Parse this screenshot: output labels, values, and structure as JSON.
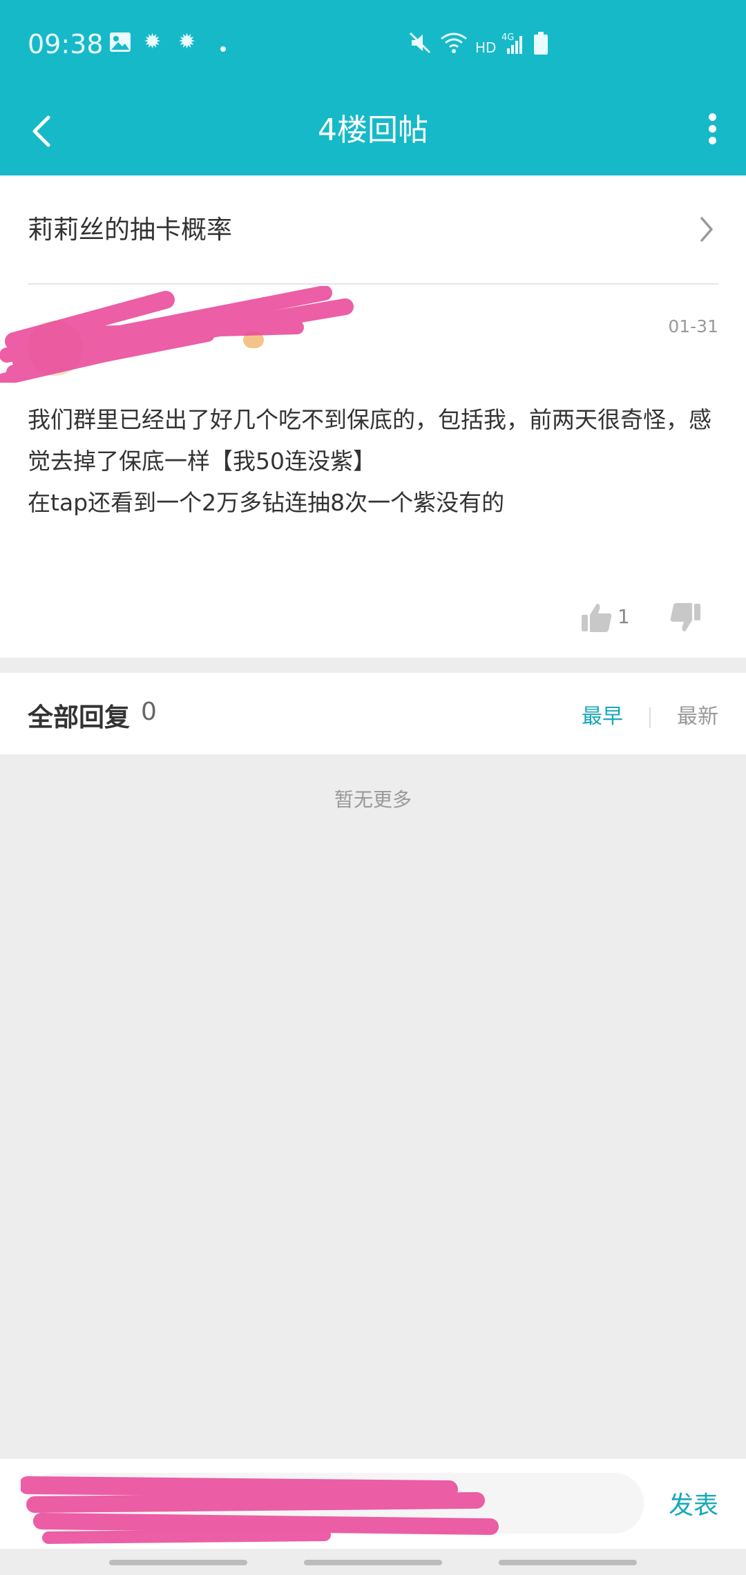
{
  "status_bar": {
    "time": "09:38",
    "icons": [
      "image-icon",
      "settings-gear-icon",
      "settings-gear-icon",
      "dot-icon",
      "mute-icon",
      "wifi-icon",
      "hd-icon",
      "signal-4g-icon",
      "battery-icon"
    ],
    "hd_label": "HD",
    "network_label": "4G"
  },
  "app_bar": {
    "title": "4楼回帖"
  },
  "thread": {
    "title": "莉莉丝的抽卡概率",
    "date": "01-31",
    "paragraphs": [
      "我们群里已经出了好几个吃不到保底的，包括我，前两天很奇怪，感觉去掉了保底一样【我50连没紫】",
      "",
      "在tap还看到一个2万多钻连抽8次一个紫没有的"
    ],
    "like_count": "1"
  },
  "replies": {
    "label": "全部回复",
    "count": "0",
    "sort_earliest": "最早",
    "sort_newest": "最新",
    "empty_text": "暂无更多"
  },
  "composer": {
    "publish_label": "发表"
  },
  "colors": {
    "accent": "#16b9c8",
    "link_accent": "#17a9b8",
    "redaction": "#ea4d9c"
  }
}
